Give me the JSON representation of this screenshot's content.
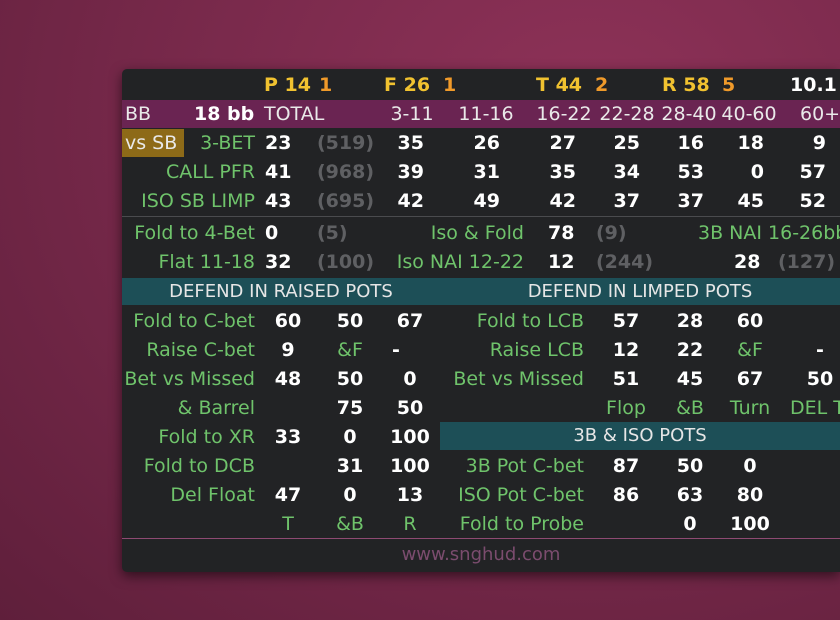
{
  "header": {
    "p_label": "P 14",
    "p_count": "1",
    "f_label": "F 26",
    "f_count": "1",
    "t_label": "T 44",
    "t_count": "2",
    "r_label": "R 58",
    "r_count": "5",
    "stack": "10.1"
  },
  "bb_row": {
    "position": "BB",
    "stack": "18 bb",
    "total": "TOTAL",
    "ranges": [
      "3-11",
      "11-16",
      "16-22",
      "22-28",
      "28-40",
      "40-60",
      "60+"
    ]
  },
  "vs_label": "vs SB",
  "preflop_rows": [
    {
      "label": "3-BET",
      "pct": "23",
      "count": "(519)",
      "values": [
        "35",
        "26",
        "27",
        "25",
        "16",
        "18",
        "9"
      ]
    },
    {
      "label": "CALL PFR",
      "pct": "41",
      "count": "(968)",
      "values": [
        "39",
        "31",
        "35",
        "34",
        "53",
        "0",
        "57"
      ]
    },
    {
      "label": "ISO SB LIMP",
      "pct": "43",
      "count": "(695)",
      "values": [
        "42",
        "49",
        "42",
        "37",
        "37",
        "45",
        "52"
      ]
    }
  ],
  "stats_rows": [
    {
      "l1": "Fold to 4-Bet",
      "v1": "0",
      "c1": "(5)",
      "l2": "Iso & Fold",
      "v2": "78",
      "c2": "(9)",
      "l3": "3B NAI 16-26bb"
    },
    {
      "l1": "Flat 11-18",
      "v1": "32",
      "c1": "(100)",
      "l2": "Iso NAI 12-22",
      "v2": "12",
      "c2": "(244)",
      "v3": "28",
      "c3": "(127)"
    }
  ],
  "sections": {
    "raised": "DEFEND IN RAISED POTS",
    "limped": "DEFEND IN LIMPED POTS",
    "threebet": "3B & ISO POTS"
  },
  "raised_rows": [
    {
      "label": "Fold to C-bet",
      "a": "60",
      "b": "50",
      "c": "67"
    },
    {
      "label": "Raise C-bet",
      "a": "9",
      "b": "&F",
      "c": "-"
    },
    {
      "label": "Bet vs Missed",
      "a": "48",
      "b": "50",
      "c": "0"
    },
    {
      "label": "& Barrel",
      "a": "",
      "b": "75",
      "c": "50"
    },
    {
      "label": "Fold to XR",
      "a": "33",
      "b": "0",
      "c": "100"
    },
    {
      "label": "Fold to DCB",
      "a": "",
      "b": "31",
      "c": "100"
    },
    {
      "label": "Del Float",
      "a": "47",
      "b": "0",
      "c": "13"
    },
    {
      "label": "",
      "a": "T",
      "b": "&B",
      "c": "R"
    }
  ],
  "limped_rows": [
    {
      "label": "Fold to LCB",
      "a": "57",
      "b": "28",
      "c": "60",
      "d": ""
    },
    {
      "label": "Raise LCB",
      "a": "12",
      "b": "22",
      "c": "&F",
      "d": "-"
    },
    {
      "label": "Bet vs Missed",
      "a": "51",
      "b": "45",
      "c": "67",
      "d": "50"
    },
    {
      "label": "",
      "a": "Flop",
      "b": "&B",
      "c": "Turn",
      "d": "DEL T"
    }
  ],
  "threebet_rows": [
    {
      "label": "3B Pot C-bet",
      "a": "87",
      "b": "50",
      "c": "0"
    },
    {
      "label": "ISO Pot C-bet",
      "a": "86",
      "b": "63",
      "c": "80"
    },
    {
      "label": "Fold to Probe",
      "a": "",
      "b": "0",
      "c": "100"
    }
  ],
  "footer": "www.snghud.com"
}
